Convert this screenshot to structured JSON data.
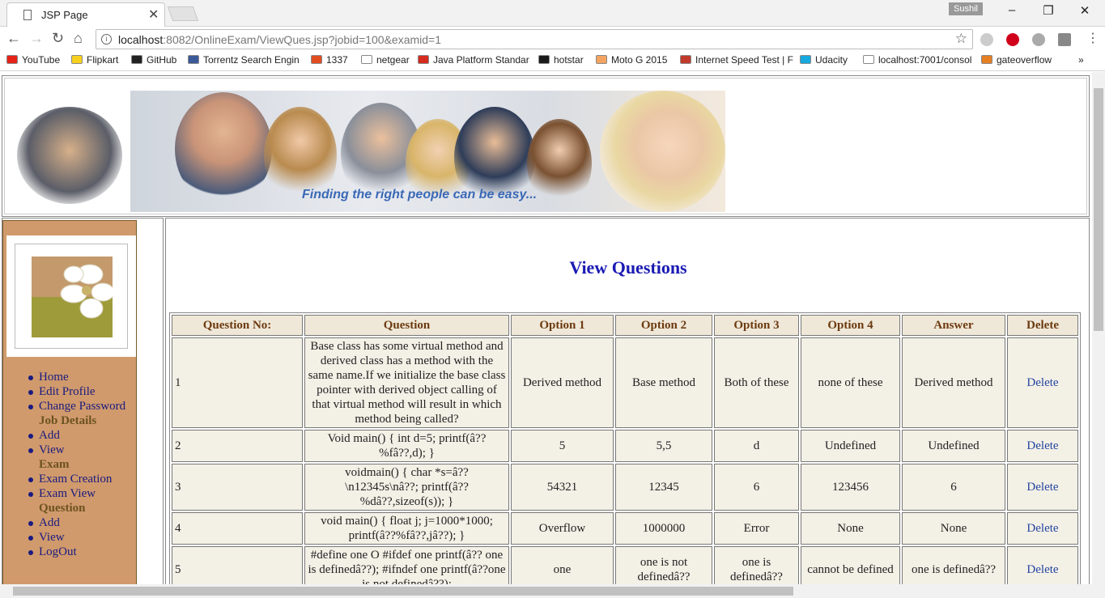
{
  "browser": {
    "tab_title": "JSP Page",
    "profile_name": "Sushil",
    "url_host": "localhost",
    "url_rest": ":8082/OnlineExam/ViewQues.jsp?jobid=100&examid=1",
    "bookmarks": [
      {
        "label": "YouTube",
        "color": "#e62117"
      },
      {
        "label": "Flipkart",
        "color": "#f7d11e"
      },
      {
        "label": "GitHub",
        "color": "#222222"
      },
      {
        "label": "Torrentz Search Engin",
        "color": "#3b5998"
      },
      {
        "label": "1337",
        "color": "#e24d20"
      },
      {
        "label": "netgear",
        "color": "#ffffff"
      },
      {
        "label": "Java Platform Standar",
        "color": "#d52b1e"
      },
      {
        "label": "hotstar",
        "color": "#1a1a1a"
      },
      {
        "label": "Moto G 2015",
        "color": "#f4a460"
      },
      {
        "label": "Internet Speed Test | F",
        "color": "#c0392b"
      },
      {
        "label": "Udacity",
        "color": "#15a9e0"
      },
      {
        "label": "localhost:7001/consol",
        "color": "#ffffff"
      },
      {
        "label": "gateoverflow",
        "color": "#e67e22"
      }
    ]
  },
  "banner": {
    "tagline": "Finding the right people can be easy..."
  },
  "sidebar": {
    "menu": [
      {
        "type": "link",
        "label": "Home"
      },
      {
        "type": "link",
        "label": "Edit Profile"
      },
      {
        "type": "link",
        "label": "Change Password"
      },
      {
        "type": "heading",
        "label": "Job Details"
      },
      {
        "type": "link",
        "label": "Add"
      },
      {
        "type": "link",
        "label": "View"
      },
      {
        "type": "heading",
        "label": "Exam"
      },
      {
        "type": "link",
        "label": "Exam Creation"
      },
      {
        "type": "link",
        "label": "Exam View"
      },
      {
        "type": "heading",
        "label": "Question"
      },
      {
        "type": "link",
        "label": "Add"
      },
      {
        "type": "link",
        "label": "View"
      },
      {
        "type": "link",
        "label": "LogOut"
      }
    ]
  },
  "main": {
    "title": "View Questions",
    "columns": [
      "Question No:",
      "Question",
      "Option 1",
      "Option 2",
      "Option 3",
      "Option 4",
      "Answer",
      "Delete"
    ],
    "rows": [
      {
        "no": "1",
        "question": "Base class has some virtual method and derived class has a method with the same name.If we initialize the base class pointer with derived object calling of that virtual method will result in which method being called?",
        "opt1": "Derived method",
        "opt2": "Base method",
        "opt3": "Both of these",
        "opt4": "none of these",
        "answer": "Derived method",
        "delete": "Delete"
      },
      {
        "no": "2",
        "question": "Void main() { int d=5; printf(â?? %fâ??,d); }",
        "opt1": "5",
        "opt2": "5,5",
        "opt3": "d",
        "opt4": "Undefined",
        "answer": "Undefined",
        "delete": "Delete"
      },
      {
        "no": "3",
        "question": "voidmain() { char *s=â?? \\n12345s\\nâ??; printf(â?? %dâ??,sizeof(s)); }",
        "opt1": "54321",
        "opt2": "12345",
        "opt3": "6",
        "opt4": "123456",
        "answer": "6",
        "delete": "Delete"
      },
      {
        "no": "4",
        "question": "void main() { float j; j=1000*1000; printf(â??%fâ??,jâ??); }",
        "opt1": "Overflow",
        "opt2": "1000000",
        "opt3": "Error",
        "opt4": "None",
        "answer": "None",
        "delete": "Delete"
      },
      {
        "no": "5",
        "question": "#define one O #ifdef one printf(â?? one is definedâ??); #ifndef one printf(â??one is not definedâ??);",
        "opt1": "one",
        "opt2": "one is not definedâ??",
        "opt3": "one is definedâ??",
        "opt4": "cannot be defined",
        "answer": "one is definedâ??",
        "delete": "Delete"
      }
    ]
  }
}
